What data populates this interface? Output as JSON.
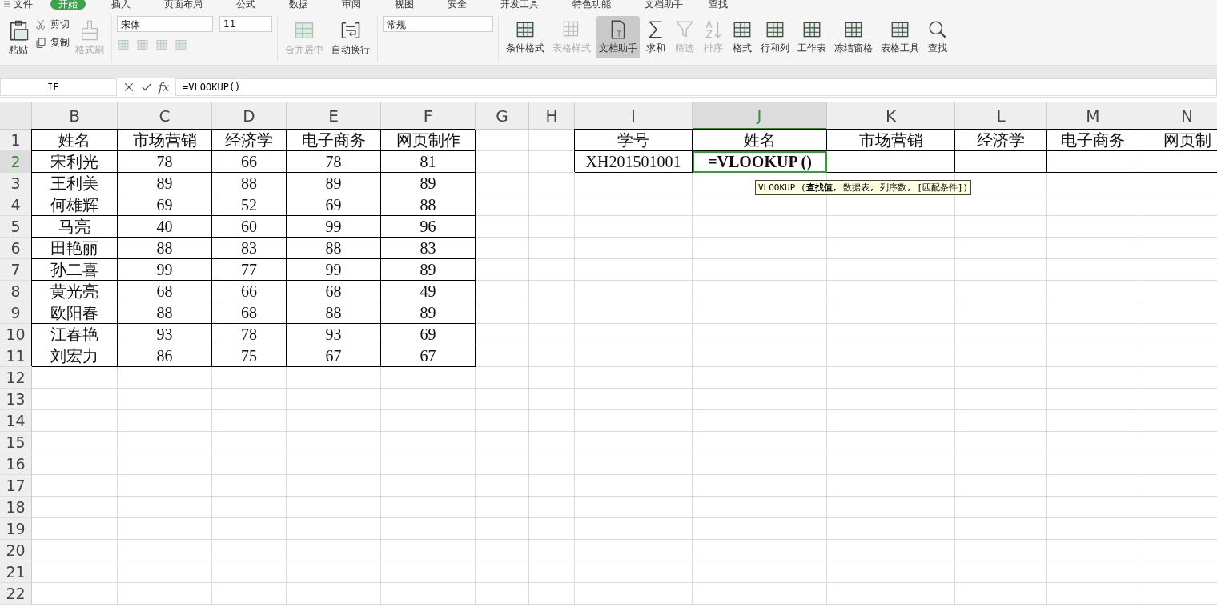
{
  "menu": {
    "file": "文件",
    "tabs": [
      {
        "label": "开始",
        "selected": true
      },
      {
        "label": "插入",
        "selected": false
      },
      {
        "label": "页面布局",
        "selected": false
      },
      {
        "label": "公式",
        "selected": false
      },
      {
        "label": "数据",
        "selected": false
      },
      {
        "label": "审阅",
        "selected": false
      },
      {
        "label": "视图",
        "selected": false
      },
      {
        "label": "安全",
        "selected": false
      },
      {
        "label": "开发工具",
        "selected": false
      },
      {
        "label": "特色功能",
        "selected": false
      },
      {
        "label": "文档助手",
        "selected": false
      }
    ],
    "search": "查找"
  },
  "ribbon": {
    "paste": {
      "label": "粘贴",
      "disabled": false
    },
    "cut": {
      "label": "剪切",
      "disabled": false
    },
    "copy": {
      "label": "复制",
      "disabled": false
    },
    "format_painter": {
      "label": "格式刷",
      "disabled": true
    },
    "font": {
      "name": "宋体",
      "size": "11"
    },
    "merge": {
      "label": "合并居中",
      "disabled": true
    },
    "wrap": {
      "label": "自动换行",
      "disabled": false
    },
    "number_format": "常规",
    "tools": [
      {
        "label": "条件格式",
        "disabled": false,
        "selected": false
      },
      {
        "label": "表格样式",
        "disabled": true,
        "selected": false
      },
      {
        "label": "文档助手",
        "disabled": false,
        "selected": true
      },
      {
        "label": "求和",
        "disabled": false,
        "selected": false
      },
      {
        "label": "筛选",
        "disabled": true,
        "selected": false
      },
      {
        "label": "排序",
        "disabled": true,
        "selected": false
      },
      {
        "label": "格式",
        "disabled": false,
        "selected": false
      },
      {
        "label": "行和列",
        "disabled": false,
        "selected": false
      },
      {
        "label": "工作表",
        "disabled": false,
        "selected": false
      },
      {
        "label": "冻结窗格",
        "disabled": false,
        "selected": false
      },
      {
        "label": "表格工具",
        "disabled": false,
        "selected": false
      },
      {
        "label": "查找",
        "disabled": false,
        "selected": false
      }
    ]
  },
  "formula_bar": {
    "name_box": "IF",
    "fx": "fx",
    "formula": "=VLOOKUP()"
  },
  "sheet": {
    "columns": [
      {
        "label": "B",
        "selected": false
      },
      {
        "label": "C",
        "selected": false
      },
      {
        "label": "D",
        "selected": false
      },
      {
        "label": "E",
        "selected": false
      },
      {
        "label": "F",
        "selected": false
      },
      {
        "label": "G",
        "selected": false
      },
      {
        "label": "H",
        "selected": false
      },
      {
        "label": "I",
        "selected": false
      },
      {
        "label": "J",
        "selected": true
      },
      {
        "label": "K",
        "selected": false
      },
      {
        "label": "L",
        "selected": false
      },
      {
        "label": "M",
        "selected": false
      },
      {
        "label": "N",
        "selected": false
      }
    ],
    "rows": [
      {
        "number": "1",
        "selected": false,
        "cells": [
          {
            "text": "姓名",
            "boxed": true
          },
          {
            "text": "市场营销",
            "boxed": true
          },
          {
            "text": "经济学",
            "boxed": true
          },
          {
            "text": "电子商务",
            "boxed": true
          },
          {
            "text": "网页制作",
            "boxed": true
          },
          null,
          null,
          {
            "text": "学号",
            "boxed": true
          },
          {
            "text": "姓名",
            "boxed": true
          },
          {
            "text": "市场营销",
            "boxed": true
          },
          {
            "text": "经济学",
            "boxed": true
          },
          {
            "text": "电子商务",
            "boxed": true
          },
          {
            "text": "网页制",
            "boxed": true
          }
        ]
      },
      {
        "number": "2",
        "selected": true,
        "cells": [
          {
            "text": "宋利光",
            "boxed": true
          },
          {
            "text": "78",
            "boxed": true
          },
          {
            "text": "66",
            "boxed": true
          },
          {
            "text": "78",
            "boxed": true
          },
          {
            "text": "81",
            "boxed": true
          },
          null,
          null,
          {
            "text": "XH201501001",
            "boxed": true
          },
          {
            "text": "=VLOOKUP ()",
            "boxed": true,
            "active": true
          },
          {
            "boxed": true
          },
          {
            "boxed": true
          },
          {
            "boxed": true
          },
          {
            "boxed": true
          }
        ]
      },
      {
        "number": "3",
        "selected": false,
        "cells": [
          {
            "text": "王利美",
            "boxed": true
          },
          {
            "text": "89",
            "boxed": true
          },
          {
            "text": "88",
            "boxed": true
          },
          {
            "text": "89",
            "boxed": true
          },
          {
            "text": "89",
            "boxed": true
          }
        ]
      },
      {
        "number": "4",
        "selected": false,
        "cells": [
          {
            "text": "何雄辉",
            "boxed": true
          },
          {
            "text": "69",
            "boxed": true
          },
          {
            "text": "52",
            "boxed": true
          },
          {
            "text": "69",
            "boxed": true
          },
          {
            "text": "88",
            "boxed": true
          }
        ]
      },
      {
        "number": "5",
        "selected": false,
        "cells": [
          {
            "text": "马亮",
            "boxed": true
          },
          {
            "text": "40",
            "boxed": true
          },
          {
            "text": "60",
            "boxed": true
          },
          {
            "text": "99",
            "boxed": true
          },
          {
            "text": "96",
            "boxed": true
          }
        ]
      },
      {
        "number": "6",
        "selected": false,
        "cells": [
          {
            "text": "田艳丽",
            "boxed": true
          },
          {
            "text": "88",
            "boxed": true
          },
          {
            "text": "83",
            "boxed": true
          },
          {
            "text": "88",
            "boxed": true
          },
          {
            "text": "83",
            "boxed": true
          }
        ]
      },
      {
        "number": "7",
        "selected": false,
        "cells": [
          {
            "text": "孙二喜",
            "boxed": true
          },
          {
            "text": "99",
            "boxed": true
          },
          {
            "text": "77",
            "boxed": true
          },
          {
            "text": "99",
            "boxed": true
          },
          {
            "text": "89",
            "boxed": true
          }
        ]
      },
      {
        "number": "8",
        "selected": false,
        "cells": [
          {
            "text": "黄光亮",
            "boxed": true
          },
          {
            "text": "68",
            "boxed": true
          },
          {
            "text": "66",
            "boxed": true
          },
          {
            "text": "68",
            "boxed": true
          },
          {
            "text": "49",
            "boxed": true
          }
        ]
      },
      {
        "number": "9",
        "selected": false,
        "cells": [
          {
            "text": "欧阳春",
            "boxed": true
          },
          {
            "text": "88",
            "boxed": true
          },
          {
            "text": "68",
            "boxed": true
          },
          {
            "text": "88",
            "boxed": true
          },
          {
            "text": "89",
            "boxed": true
          }
        ]
      },
      {
        "number": "10",
        "selected": false,
        "cells": [
          {
            "text": "江春艳",
            "boxed": true
          },
          {
            "text": "93",
            "boxed": true
          },
          {
            "text": "78",
            "boxed": true
          },
          {
            "text": "93",
            "boxed": true
          },
          {
            "text": "69",
            "boxed": true
          }
        ]
      },
      {
        "number": "11",
        "selected": false,
        "cells": [
          {
            "text": "刘宏力",
            "boxed": true
          },
          {
            "text": "86",
            "boxed": true
          },
          {
            "text": "75",
            "boxed": true
          },
          {
            "text": "67",
            "boxed": true
          },
          {
            "text": "67",
            "boxed": true
          }
        ]
      },
      {
        "number": "12",
        "selected": false
      },
      {
        "number": "13",
        "selected": false
      },
      {
        "number": "14",
        "selected": false
      },
      {
        "number": "15",
        "selected": false
      },
      {
        "number": "16",
        "selected": false
      },
      {
        "number": "17",
        "selected": false
      },
      {
        "number": "18",
        "selected": false
      },
      {
        "number": "19",
        "selected": false
      },
      {
        "number": "20",
        "selected": false
      },
      {
        "number": "21",
        "selected": false
      },
      {
        "number": "22",
        "selected": false
      }
    ]
  },
  "tooltip": "VLOOKUP (**查找值**, 数据表, 列序数, [匹配条件])"
}
